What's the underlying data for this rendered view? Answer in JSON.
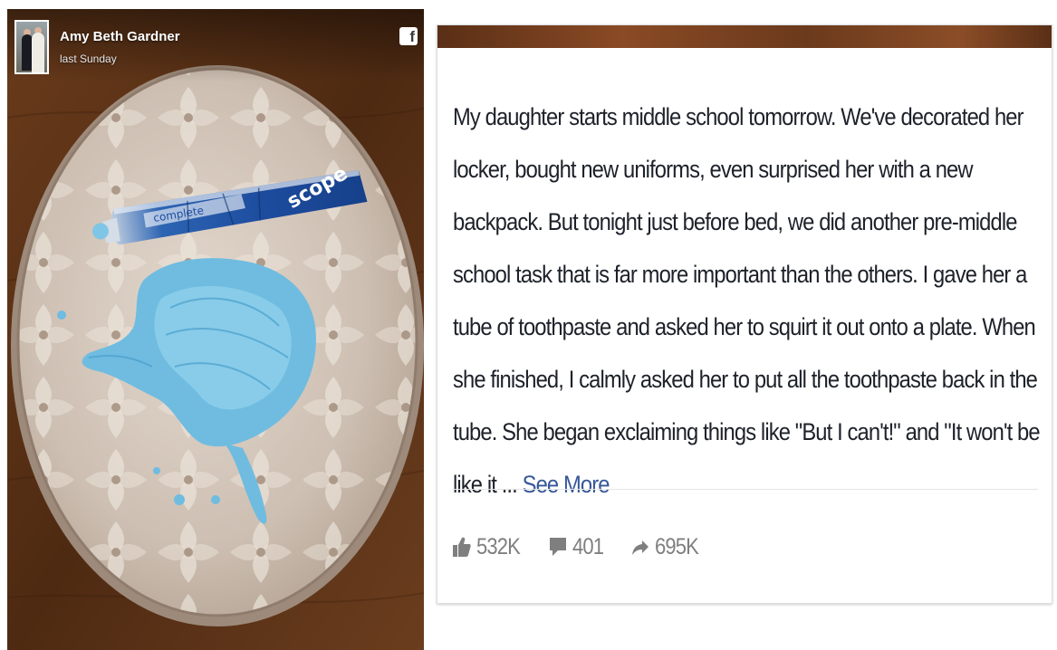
{
  "photo": {
    "author_name": "Amy Beth Gardner",
    "timestamp": "last Sunday",
    "network_icon": "facebook-icon",
    "network_icon_glyph": "f",
    "tube_brand": "scope",
    "tube_product": "complete"
  },
  "post": {
    "text": "My daughter starts middle school tomorrow. We've decorated her locker, bought new uniforms, even surprised her with a new backpack. But tonight just before bed, we did another pre-middle school task that is far more important than the others. I gave her a tube of toothpaste and asked her to squirt it out onto a plate. When she finished, I calmly asked her to put all the toothpaste back in the tube. She began exclaiming things like \"But I can't!\" and \"It won't be like it ...",
    "see_more_label": "See More"
  },
  "stats": {
    "likes": "532K",
    "comments": "401",
    "shares": "695K"
  },
  "colors": {
    "link": "#365899",
    "stat_text": "#7f7f7f",
    "body_text": "#1d2129",
    "toothpaste": "#63b6dc"
  }
}
